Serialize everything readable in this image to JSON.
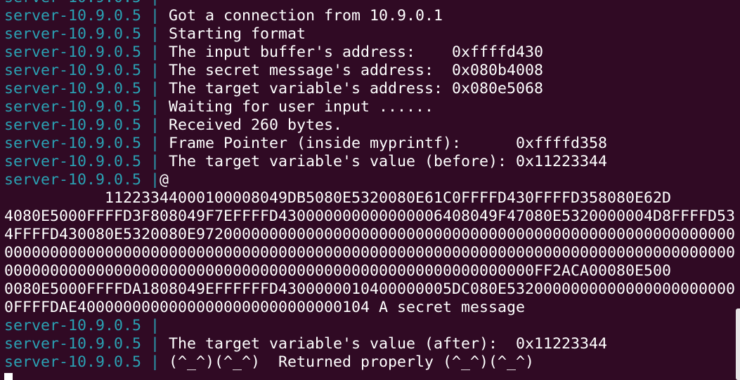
{
  "terminal": {
    "top_partial": "server-10.9.0.5 | ",
    "lines": [
      {
        "prefix": "server-10.9.0.5 | ",
        "text": "Got a connection from 10.9.0.1"
      },
      {
        "prefix": "server-10.9.0.5 | ",
        "text": "Starting format"
      },
      {
        "prefix": "server-10.9.0.5 | ",
        "text": "The input buffer's address:    0xffffd430"
      },
      {
        "prefix": "server-10.9.0.5 | ",
        "text": "The secret message's address:  0x080b4008"
      },
      {
        "prefix": "server-10.9.0.5 | ",
        "text": "The target variable's address: 0x080e5068"
      },
      {
        "prefix": "server-10.9.0.5 | ",
        "text": "Waiting for user input ......"
      },
      {
        "prefix": "server-10.9.0.5 | ",
        "text": "Received 260 bytes."
      },
      {
        "prefix": "server-10.9.0.5 | ",
        "text": "Frame Pointer (inside myprintf):      0xffffd358"
      },
      {
        "prefix": "server-10.9.0.5 | ",
        "text": "The target variable's value (before): 0x11223344"
      },
      {
        "prefix": "server-10.9.0.5 |",
        "text": "@"
      }
    ],
    "dump": [
      "           11223344000100008049DB5080E5320080E61C0FFFFD430FFFFD358080E62D",
      "4080E5000FFFFD3F808049F7EFFFFD430000000000000006408049F47080E5320000004D8FFFFD53",
      "4FFFFD430080E5320080E97200000000000000000000000000000000000000000000000000000000",
      "00000000000000000000000000000000000000000000000000000000000000000000000000000000",
      "0000000000000000000000000000000000000000000000000000000000FF2ACA00080E500",
      "0080E5000FFFFDA1808049EFFFFFFD4300000010400000005DC080E5320000000000000000000000000",
      "0FFFFDAE40000000000000000000000000000104 A secret message"
    ],
    "after_lines": [
      {
        "prefix": "server-10.9.0.5 | ",
        "text": ""
      },
      {
        "prefix": "server-10.9.0.5 | ",
        "text": "The target variable's value (after):  0x11223344"
      },
      {
        "prefix": "server-10.9.0.5 | ",
        "text": "(^_^)(^_^)  Returned properly (^_^)(^_^)"
      }
    ],
    "colors": {
      "background": "#300a24",
      "prefix": "#2aa1b3",
      "text": "#ffffff"
    }
  }
}
